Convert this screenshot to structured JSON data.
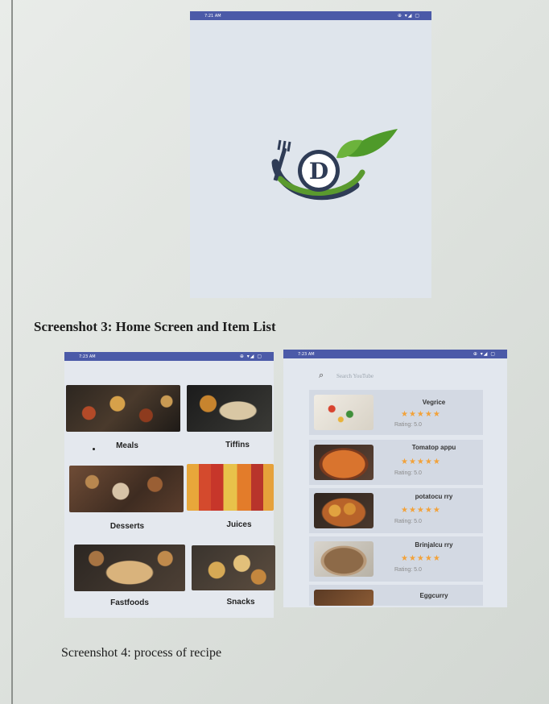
{
  "captions": {
    "screenshot3": "Screenshot 3: Home Screen and Item List",
    "screenshot4": "Screenshot 4: process of recipe"
  },
  "splash": {
    "status_time": "7:21 AM",
    "status_icons": "⊕ ▾◢ ▢",
    "logo_letter": "D",
    "logo_colors": {
      "navy": "#2f3c56",
      "green": "#5a9a2e",
      "leaf": "#4f9a2a"
    }
  },
  "home": {
    "status_time": "7:23 AM",
    "status_icons": "⊕ ▾◢ ▢",
    "categories": [
      {
        "label": "Meals",
        "icon": "meals-photo"
      },
      {
        "label": "Tiffins",
        "icon": "tiffins-photo"
      },
      {
        "label": "Desserts",
        "icon": "desserts-photo"
      },
      {
        "label": "Juices",
        "icon": "juices-photo"
      },
      {
        "label": "Fastfoods",
        "icon": "fastfoods-photo"
      },
      {
        "label": "Snacks",
        "icon": "snacks-photo"
      }
    ]
  },
  "items": {
    "status_time": "7:23 AM",
    "status_icons": "⊕ ▾◢ ▢",
    "search_placeholder": "Search YouTube",
    "star_color": "#f2a23a",
    "list": [
      {
        "name": "Vegrice",
        "stars": "★★★★★",
        "rating": "Rating: 5.0"
      },
      {
        "name": "Tomatop appu",
        "stars": "★★★★★",
        "rating": "Rating: 5.0"
      },
      {
        "name": "potatocu rry",
        "stars": "★★★★★",
        "rating": "Rating: 5.0"
      },
      {
        "name": "Brinjalcu rry",
        "stars": "★★★★★",
        "rating": "Rating: 5.0"
      },
      {
        "name": "Eggcurry",
        "stars": "",
        "rating": ""
      }
    ]
  }
}
